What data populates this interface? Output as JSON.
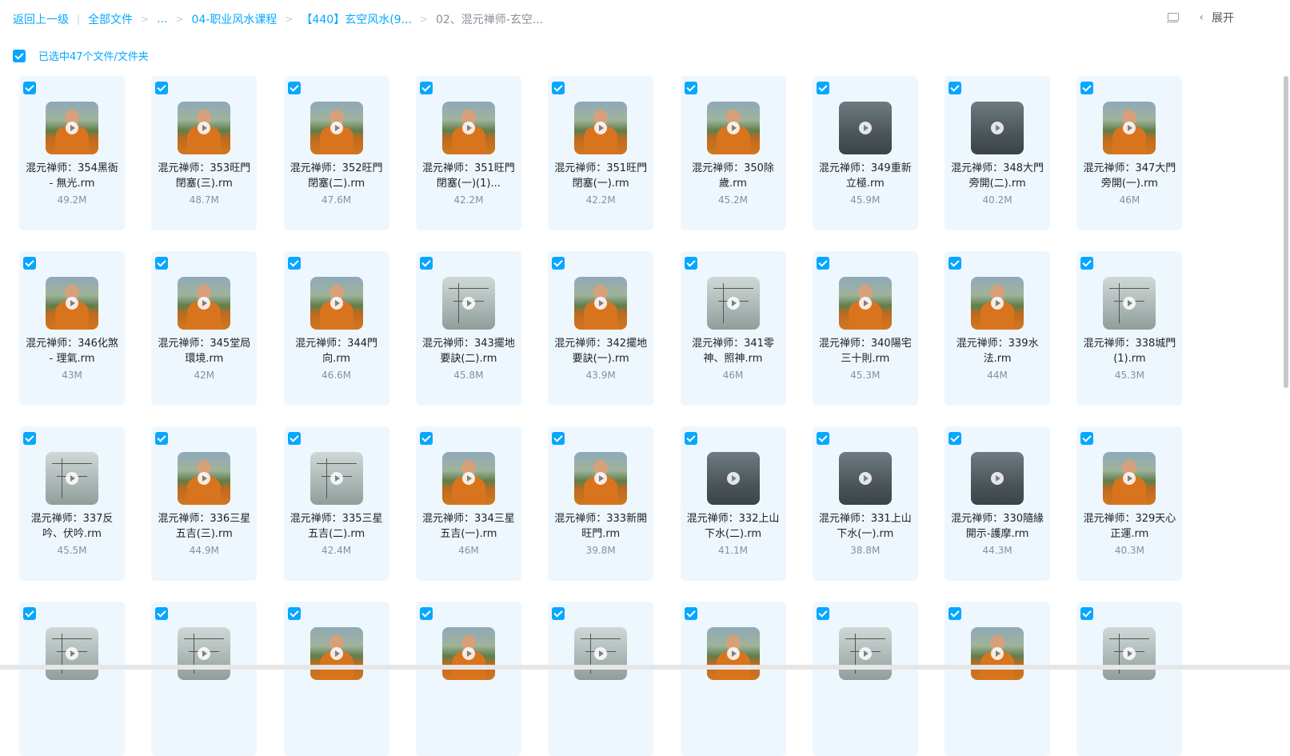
{
  "breadcrumb": {
    "back": "返回上一级",
    "all_files": "全部文件",
    "ellipsis": "...",
    "c1": "04-职业风水课程",
    "c2": "【440】玄空风水(9...",
    "c3": "02、混元禅师-玄空..."
  },
  "top_right": {
    "expand_label": "展开",
    "doc_icon": "doc-icon",
    "chevron_icon": "chevron-left-icon"
  },
  "selection": {
    "text": "已选中47个文件/文件夹"
  },
  "colors": {
    "accent": "#06a7ff",
    "card_bg": "#eef7fe"
  },
  "files": [
    {
      "name": "混元禅师：354黑衙 - 無光.rm",
      "size": "49.2M",
      "thumb": "monk"
    },
    {
      "name": "混元禅师：353旺門閉塞(三).rm",
      "size": "48.7M",
      "thumb": "monk"
    },
    {
      "name": "混元禅师：352旺門閉塞(二).rm",
      "size": "47.6M",
      "thumb": "monk"
    },
    {
      "name": "混元禅师：351旺門閉塞(一)(1)...",
      "size": "42.2M",
      "thumb": "monk"
    },
    {
      "name": "混元禅师：351旺門閉塞(一).rm",
      "size": "42.2M",
      "thumb": "monk"
    },
    {
      "name": "混元禅师：350除歲.rm",
      "size": "45.2M",
      "thumb": "monk"
    },
    {
      "name": "混元禅师：349重新立極.rm",
      "size": "45.9M",
      "thumb": "dark"
    },
    {
      "name": "混元禅师：348大門旁開(二).rm",
      "size": "40.2M",
      "thumb": "dark"
    },
    {
      "name": "混元禅师：347大門旁開(一).rm",
      "size": "46M",
      "thumb": "monk"
    },
    {
      "name": "混元禅师：346化煞 - 理氣.rm",
      "size": "43M",
      "thumb": "monk"
    },
    {
      "name": "混元禅师：345堂局環境.rm",
      "size": "42M",
      "thumb": "monk"
    },
    {
      "name": "混元禅师：344門向.rm",
      "size": "46.6M",
      "thumb": "monk"
    },
    {
      "name": "混元禅师：343擺地要訣(二).rm",
      "size": "45.8M",
      "thumb": "board"
    },
    {
      "name": "混元禅师：342擺地要訣(一).rm",
      "size": "43.9M",
      "thumb": "monk"
    },
    {
      "name": "混元禅师：341零神、照神.rm",
      "size": "46M",
      "thumb": "board"
    },
    {
      "name": "混元禅师：340陽宅三十則.rm",
      "size": "45.3M",
      "thumb": "monk"
    },
    {
      "name": "混元禅师：339水法.rm",
      "size": "44M",
      "thumb": "monk"
    },
    {
      "name": "混元禅师：338城門(1).rm",
      "size": "45.3M",
      "thumb": "board"
    },
    {
      "name": "混元禅师：337反吟、伏吟.rm",
      "size": "45.5M",
      "thumb": "board"
    },
    {
      "name": "混元禅师：336三星五吉(三).rm",
      "size": "44.9M",
      "thumb": "monk"
    },
    {
      "name": "混元禅师：335三星五吉(二).rm",
      "size": "42.4M",
      "thumb": "board"
    },
    {
      "name": "混元禅师：334三星五吉(一).rm",
      "size": "46M",
      "thumb": "monk"
    },
    {
      "name": "混元禅师：333新開旺門.rm",
      "size": "39.8M",
      "thumb": "monk"
    },
    {
      "name": "混元禅师：332上山下水(二).rm",
      "size": "41.1M",
      "thumb": "dark"
    },
    {
      "name": "混元禅师：331上山下水(一).rm",
      "size": "38.8M",
      "thumb": "dark"
    },
    {
      "name": "混元禅师：330隨緣開示-護摩.rm",
      "size": "44.3M",
      "thumb": "dark"
    },
    {
      "name": "混元禅师：329天心正運.rm",
      "size": "40.3M",
      "thumb": "monk"
    },
    {
      "name": "",
      "size": "",
      "thumb": "board"
    },
    {
      "name": "",
      "size": "",
      "thumb": "board"
    },
    {
      "name": "",
      "size": "",
      "thumb": "monk"
    },
    {
      "name": "",
      "size": "",
      "thumb": "monk"
    },
    {
      "name": "",
      "size": "",
      "thumb": "board"
    },
    {
      "name": "",
      "size": "",
      "thumb": "monk"
    },
    {
      "name": "",
      "size": "",
      "thumb": "board"
    },
    {
      "name": "",
      "size": "",
      "thumb": "monk"
    },
    {
      "name": "",
      "size": "",
      "thumb": "board"
    }
  ]
}
